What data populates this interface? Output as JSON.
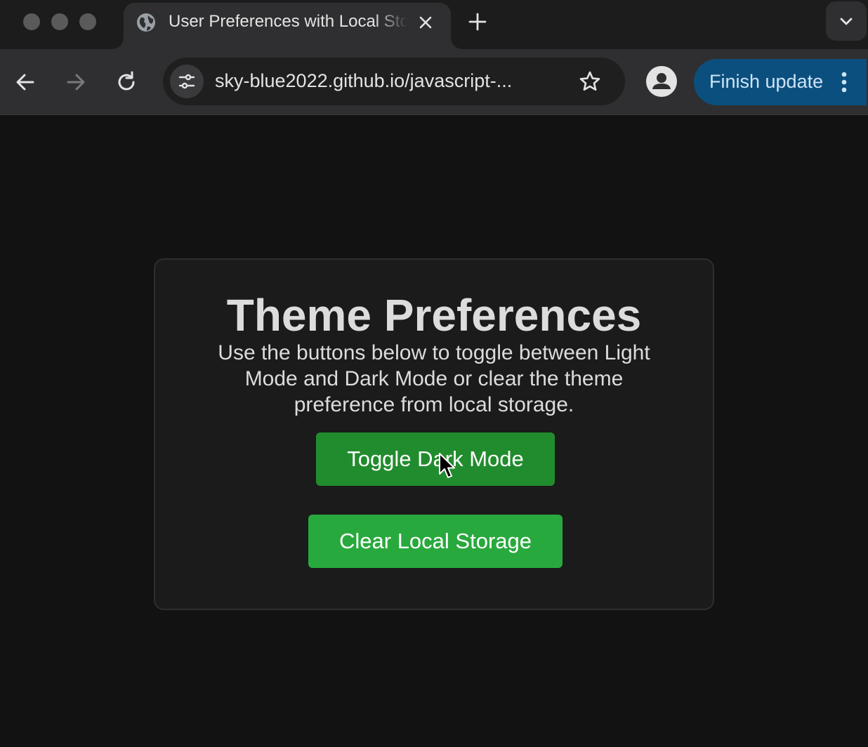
{
  "browser": {
    "tab": {
      "title": "User Preferences with Local Storage",
      "favicon": "globe-icon",
      "close_icon": "close-icon"
    },
    "new_tab_icon": "plus-icon",
    "tab_search_icon": "chevron-down-icon",
    "toolbar": {
      "back_icon": "arrow-left-icon",
      "forward_icon": "arrow-right-icon",
      "reload_icon": "reload-icon",
      "site_info_icon": "tune-icon",
      "url": "sky-blue2022.github.io/javascript-...",
      "bookmark_icon": "star-icon",
      "profile_icon": "person-icon",
      "update_button": "Finish update",
      "menu_icon": "kebab-icon"
    }
  },
  "page": {
    "title": "Theme Preferences",
    "description": "Use the buttons below to toggle between Light Mode and Dark Mode or clear the theme preference from local storage.",
    "toggle_button": "Toggle Dark Mode",
    "clear_button": "Clear Local Storage"
  },
  "colors": {
    "page_background": "#121212",
    "card_background": "#1b1b1b",
    "toggle_button": "#218c2d",
    "clear_button": "#28a93d",
    "update_button": "#0b4f7e"
  }
}
